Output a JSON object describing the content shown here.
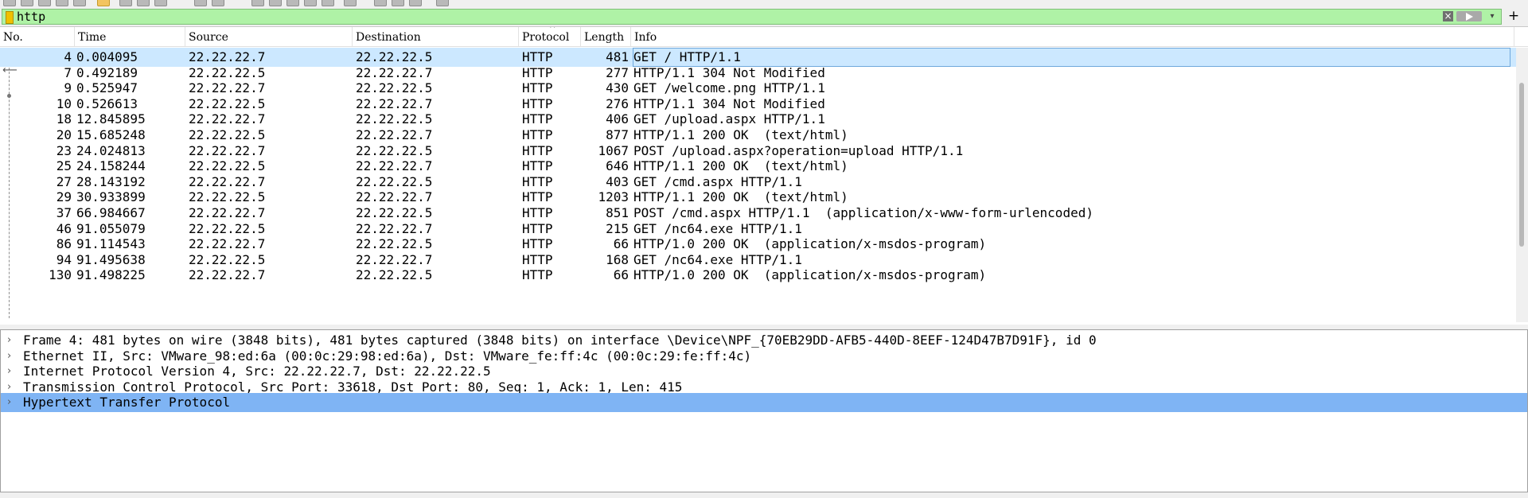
{
  "filter": {
    "value": "http",
    "clear_icon": "×",
    "dropdown_icon": "▾",
    "add_icon": "+"
  },
  "packet_list": {
    "columns": [
      "No.",
      "Time",
      "Source",
      "Destination",
      "Protocol",
      "Length",
      "Info"
    ],
    "rows": [
      {
        "no": "4",
        "time": "0.004095",
        "src": "22.22.22.7",
        "dst": "22.22.22.5",
        "proto": "HTTP",
        "len": "481",
        "info": "GET / HTTP/1.1"
      },
      {
        "no": "7",
        "time": "0.492189",
        "src": "22.22.22.5",
        "dst": "22.22.22.7",
        "proto": "HTTP",
        "len": "277",
        "info": "HTTP/1.1 304 Not Modified"
      },
      {
        "no": "9",
        "time": "0.525947",
        "src": "22.22.22.7",
        "dst": "22.22.22.5",
        "proto": "HTTP",
        "len": "430",
        "info": "GET /welcome.png HTTP/1.1"
      },
      {
        "no": "10",
        "time": "0.526613",
        "src": "22.22.22.5",
        "dst": "22.22.22.7",
        "proto": "HTTP",
        "len": "276",
        "info": "HTTP/1.1 304 Not Modified"
      },
      {
        "no": "18",
        "time": "12.845895",
        "src": "22.22.22.7",
        "dst": "22.22.22.5",
        "proto": "HTTP",
        "len": "406",
        "info": "GET /upload.aspx HTTP/1.1"
      },
      {
        "no": "20",
        "time": "15.685248",
        "src": "22.22.22.5",
        "dst": "22.22.22.7",
        "proto": "HTTP",
        "len": "877",
        "info": "HTTP/1.1 200 OK  (text/html)"
      },
      {
        "no": "23",
        "time": "24.024813",
        "src": "22.22.22.7",
        "dst": "22.22.22.5",
        "proto": "HTTP",
        "len": "1067",
        "info": "POST /upload.aspx?operation=upload HTTP/1.1"
      },
      {
        "no": "25",
        "time": "24.158244",
        "src": "22.22.22.5",
        "dst": "22.22.22.7",
        "proto": "HTTP",
        "len": "646",
        "info": "HTTP/1.1 200 OK  (text/html)"
      },
      {
        "no": "27",
        "time": "28.143192",
        "src": "22.22.22.7",
        "dst": "22.22.22.5",
        "proto": "HTTP",
        "len": "403",
        "info": "GET /cmd.aspx HTTP/1.1"
      },
      {
        "no": "29",
        "time": "30.933899",
        "src": "22.22.22.5",
        "dst": "22.22.22.7",
        "proto": "HTTP",
        "len": "1203",
        "info": "HTTP/1.1 200 OK  (text/html)"
      },
      {
        "no": "37",
        "time": "66.984667",
        "src": "22.22.22.7",
        "dst": "22.22.22.5",
        "proto": "HTTP",
        "len": "851",
        "info": "POST /cmd.aspx HTTP/1.1  (application/x-www-form-urlencoded)"
      },
      {
        "no": "46",
        "time": "91.055079",
        "src": "22.22.22.5",
        "dst": "22.22.22.7",
        "proto": "HTTP",
        "len": "215",
        "info": "GET /nc64.exe HTTP/1.1"
      },
      {
        "no": "86",
        "time": "91.114543",
        "src": "22.22.22.7",
        "dst": "22.22.22.5",
        "proto": "HTTP",
        "len": "66",
        "info": "HTTP/1.0 200 OK  (application/x-msdos-program)"
      },
      {
        "no": "94",
        "time": "91.495638",
        "src": "22.22.22.5",
        "dst": "22.22.22.7",
        "proto": "HTTP",
        "len": "168",
        "info": "GET /nc64.exe HTTP/1.1"
      },
      {
        "no": "130",
        "time": "91.498225",
        "src": "22.22.22.7",
        "dst": "22.22.22.5",
        "proto": "HTTP",
        "len": "66",
        "info": "HTTP/1.0 200 OK  (application/x-msdos-program)"
      }
    ],
    "selected_no": "4"
  },
  "details": {
    "lines": [
      {
        "text": "Frame 4: 481 bytes on wire (3848 bits), 481 bytes captured (3848 bits) on interface \\Device\\NPF_{70EB29DD-AFB5-440D-8EEF-124D47B7D91F}, id 0",
        "selected": false
      },
      {
        "text": "Ethernet II, Src: VMware_98:ed:6a (00:0c:29:98:ed:6a), Dst: VMware_fe:ff:4c (00:0c:29:fe:ff:4c)",
        "selected": false
      },
      {
        "text": "Internet Protocol Version 4, Src: 22.22.22.7, Dst: 22.22.22.5",
        "selected": false
      },
      {
        "text": "Transmission Control Protocol, Src Port: 33618, Dst Port: 80, Seq: 1, Ack: 1, Len: 415",
        "selected": false
      },
      {
        "text": "Hypertext Transfer Protocol",
        "selected": true
      }
    ],
    "expander_icon": "›"
  },
  "colors": {
    "filter_valid_bg": "#aff2a6",
    "row_selected": "#cce8ff",
    "detail_selected": "#7fb4f4"
  }
}
